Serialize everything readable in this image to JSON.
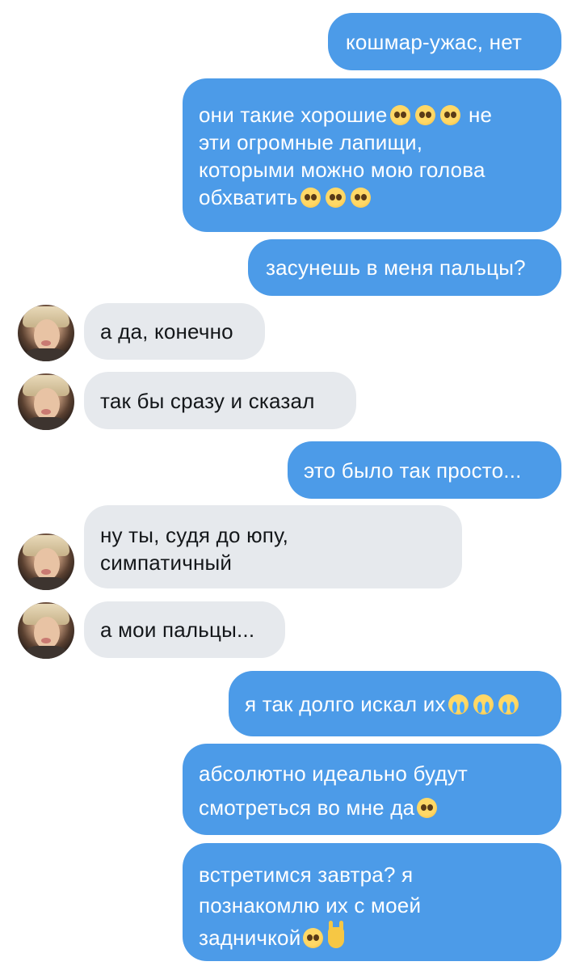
{
  "colors": {
    "outgoing_bubble": "#4c9be8",
    "incoming_bubble": "#e6e9ed",
    "outgoing_text": "#ffffff",
    "incoming_text": "#14171a"
  },
  "messages": [
    {
      "direction": "out",
      "lines": [
        "кошмар-ужас, нет"
      ]
    },
    {
      "direction": "out",
      "lines": [
        "они такие хорошие",
        "эти огромные лапищи,",
        "которыми можно мою голова",
        "обхватить"
      ],
      "emoji": [
        "pleading-face-emoji",
        "pleading-face-emoji",
        "pleading-face-emoji",
        "не",
        "pleading-face-emoji",
        "pleading-face-emoji",
        "pleading-face-emoji"
      ]
    },
    {
      "direction": "out",
      "lines": [
        "засунешь в меня пальцы?"
      ]
    },
    {
      "direction": "in",
      "lines": [
        "а да, конечно"
      ]
    },
    {
      "direction": "in",
      "lines": [
        "так бы сразу и сказал"
      ]
    },
    {
      "direction": "out",
      "lines": [
        "это было так просто..."
      ]
    },
    {
      "direction": "in",
      "lines": [
        "ну ты, судя до юпу,",
        "симпатичный"
      ]
    },
    {
      "direction": "in",
      "lines": [
        "а мои пальцы..."
      ]
    },
    {
      "direction": "out",
      "lines": [
        "я так долго искал их"
      ],
      "emoji": [
        "loudly-crying-emoji",
        "loudly-crying-emoji",
        "loudly-crying-emoji"
      ]
    },
    {
      "direction": "out",
      "lines": [
        "абсолютно идеально будут",
        "смотреться во мне да"
      ],
      "emoji": [
        "pleading-face-emoji"
      ]
    },
    {
      "direction": "out",
      "lines": [
        "встретимся завтра? я",
        "познакомлю их с моей",
        "задничкой"
      ],
      "emoji": [
        "pleading-face-emoji",
        "rock-on-hand-emoji"
      ]
    }
  ],
  "line_suffix": {
    "m2_l1": "не"
  }
}
